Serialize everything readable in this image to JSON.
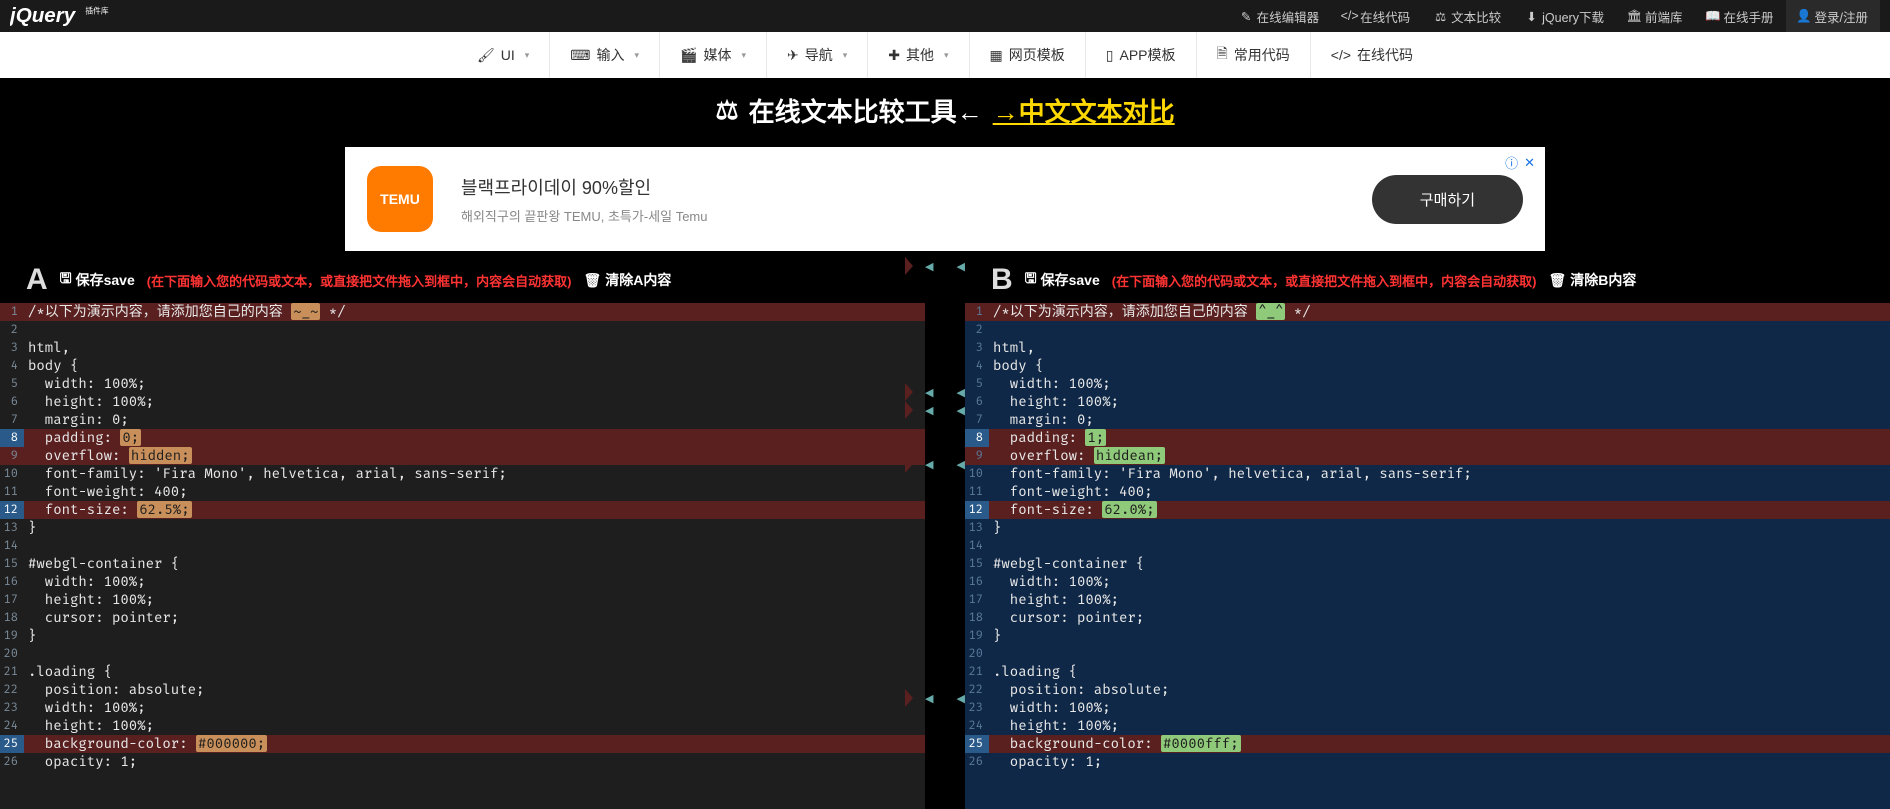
{
  "topnav": {
    "editor": "在线编辑器",
    "code": "在线代码",
    "diff": "文本比较",
    "download": "jQuery下载",
    "frontend": "前端库",
    "manual": "在线手册",
    "login": "登录/注册"
  },
  "menu": {
    "ui": "UI",
    "input": "输入",
    "media": "媒体",
    "nav": "导航",
    "other": "其他",
    "web_tpl": "网页模板",
    "app_tpl": "APP模板",
    "common_code": "常用代码",
    "online_code": "在线代码"
  },
  "title": {
    "plain": "在线文本比较工具←",
    "link": "→中文文本对比"
  },
  "ad": {
    "logo": "TEMU",
    "line1": "블랙프라이데이 90%할인",
    "line2": "해외직구의 끝판왕 TEMU, 초특가-세일 Temu",
    "btn": "구매하기"
  },
  "pane": {
    "save": "保存save",
    "hint": "(在下面输入您的代码或文本，或直接把文件拖入到框中，内容会自动获取)",
    "clear_a": "清除A内容",
    "clear_b": "清除B内容"
  },
  "codeA": [
    {
      "n": 1,
      "t": "/*以下为演示内容，请添加您自己的内容 ",
      "d": "del",
      "chg": "~_~",
      "after": " */"
    },
    {
      "n": 2,
      "t": ""
    },
    {
      "n": 3,
      "t": "html,"
    },
    {
      "n": 4,
      "t": "body {"
    },
    {
      "n": 5,
      "t": "  width: 100%;"
    },
    {
      "n": 6,
      "t": "  height: 100%;"
    },
    {
      "n": 7,
      "t": "  margin: 0;"
    },
    {
      "n": 8,
      "t": "  padding: ",
      "d": "del",
      "chg": "0;",
      "active": true
    },
    {
      "n": 9,
      "t": "  overflow: ",
      "d": "del",
      "chg": "hidden;"
    },
    {
      "n": 10,
      "t": "  font-family: 'Fira Mono', helvetica, arial, sans-serif;"
    },
    {
      "n": 11,
      "t": "  font-weight: 400;"
    },
    {
      "n": 12,
      "t": "  font-size: ",
      "d": "del",
      "chg": "62.5%;",
      "active": true
    },
    {
      "n": 13,
      "t": "}"
    },
    {
      "n": 14,
      "t": ""
    },
    {
      "n": 15,
      "t": "#webgl-container {"
    },
    {
      "n": 16,
      "t": "  width: 100%;"
    },
    {
      "n": 17,
      "t": "  height: 100%;"
    },
    {
      "n": 18,
      "t": "  cursor: pointer;"
    },
    {
      "n": 19,
      "t": "}"
    },
    {
      "n": 20,
      "t": ""
    },
    {
      "n": 21,
      "t": ".loading {"
    },
    {
      "n": 22,
      "t": "  position: absolute;"
    },
    {
      "n": 23,
      "t": "  width: 100%;"
    },
    {
      "n": 24,
      "t": "  height: 100%;"
    },
    {
      "n": 25,
      "t": "  background-color: ",
      "d": "del",
      "chg": "#000000;",
      "active": true
    },
    {
      "n": 26,
      "t": "  opacity: 1;"
    }
  ],
  "codeB": [
    {
      "n": 1,
      "t": "/*以下为演示内容，请添加您自己的内容 ",
      "d": "add",
      "chg": "^_^",
      "after": " */"
    },
    {
      "n": 2,
      "t": ""
    },
    {
      "n": 3,
      "t": "html,"
    },
    {
      "n": 4,
      "t": "body {"
    },
    {
      "n": 5,
      "t": "  width: 100%;"
    },
    {
      "n": 6,
      "t": "  height: 100%;"
    },
    {
      "n": 7,
      "t": "  margin: 0;"
    },
    {
      "n": 8,
      "t": "  padding: ",
      "d": "add",
      "chg": "1;",
      "active": true
    },
    {
      "n": 9,
      "t": "  overflow: ",
      "d": "add",
      "chg": "hiddean;"
    },
    {
      "n": 10,
      "t": "  font-family: 'Fira Mono', helvetica, arial, sans-serif;"
    },
    {
      "n": 11,
      "t": "  font-weight: 400;"
    },
    {
      "n": 12,
      "t": "  font-size: ",
      "d": "add",
      "chg": "62.0%;",
      "active": true
    },
    {
      "n": 13,
      "t": "}"
    },
    {
      "n": 14,
      "t": ""
    },
    {
      "n": 15,
      "t": "#webgl-container {"
    },
    {
      "n": 16,
      "t": "  width: 100%;"
    },
    {
      "n": 17,
      "t": "  height: 100%;"
    },
    {
      "n": 18,
      "t": "  cursor: pointer;"
    },
    {
      "n": 19,
      "t": "}"
    },
    {
      "n": 20,
      "t": ""
    },
    {
      "n": 21,
      "t": ".loading {"
    },
    {
      "n": 22,
      "t": "  position: absolute;"
    },
    {
      "n": 23,
      "t": "  width: 100%;"
    },
    {
      "n": 24,
      "t": "  height: 100%;"
    },
    {
      "n": 25,
      "t": "  background-color: ",
      "d": "add",
      "chg": "#0000fff;",
      "active": true
    },
    {
      "n": 26,
      "t": "  opacity: 1;"
    }
  ],
  "connectors": [
    0,
    7,
    8,
    11,
    24
  ]
}
